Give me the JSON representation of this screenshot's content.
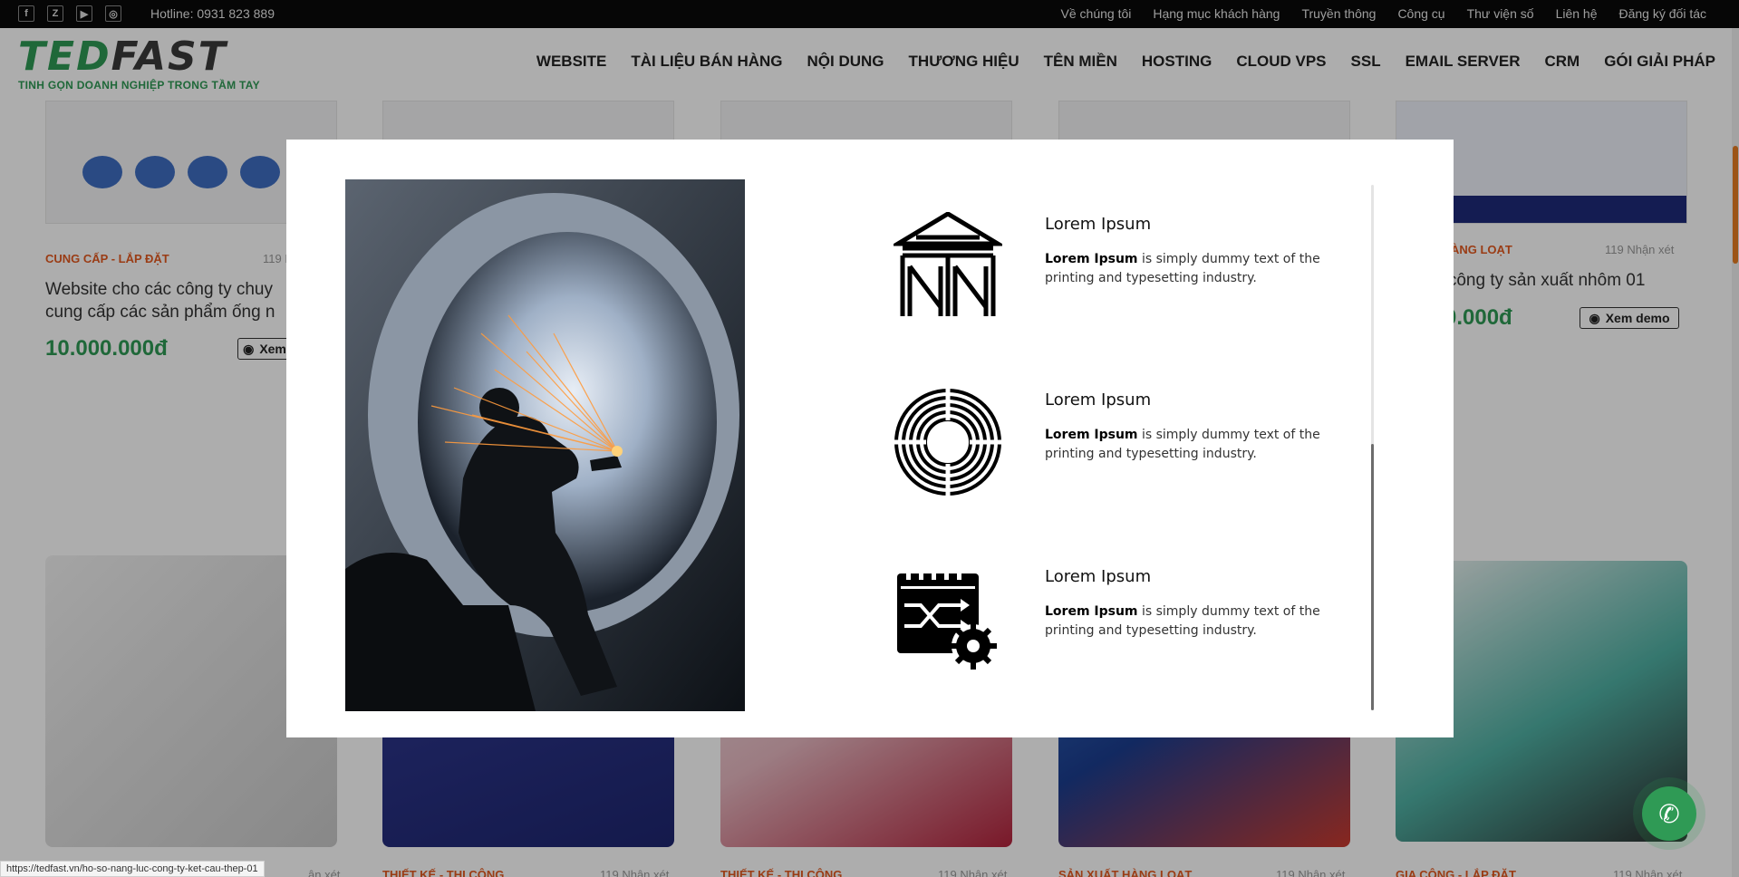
{
  "topbar": {
    "hotline": "Hotline: 0931 823 889",
    "links": [
      "Về chúng tôi",
      "Hạng mục khách hàng",
      "Truyền thông",
      "Công cụ",
      "Thư viện số",
      "Liên hệ",
      "Đăng ký đối tác"
    ],
    "socials": [
      "facebook-icon",
      "zalo-icon",
      "youtube-icon",
      "instagram-icon"
    ]
  },
  "header": {
    "logo_ted": "TED",
    "logo_fast": "FAST",
    "slogan": "TINH GỌN DOANH NGHIỆP TRONG TẦM TAY",
    "nav": [
      "WEBSITE",
      "TÀI LIỆU BÁN HÀNG",
      "NỘI DUNG",
      "THƯƠNG HIỆU",
      "TÊN MIỀN",
      "HOSTING",
      "CLOUD VPS",
      "SSL",
      "EMAIL SERVER",
      "CRM",
      "GÓI GIẢI PHÁP"
    ]
  },
  "cards_top": [
    {
      "category": "CUNG CẤP - LẮP ĐẶT",
      "reviews": "119 N",
      "title_line1": "Website cho các công ty chuy",
      "title_line2": "cung cấp các sản phẩm ống n",
      "price": "10.000.000đ",
      "demo": "Xem"
    },
    {
      "category": "T HÀNG LOẠT",
      "reviews": "119 Nhận xét",
      "title_line1": "e công ty sản xuất nhôm 01",
      "price": "0.000đ",
      "demo": "Xem demo"
    }
  ],
  "cards_bottom": [
    {
      "category": "",
      "reviews": "ận xét"
    },
    {
      "category": "THIẾT KẾ - THI CÔNG",
      "reviews": "119 Nhận xét"
    },
    {
      "category": "THIẾT KẾ - THI CÔNG",
      "reviews": "119 Nhận xét"
    },
    {
      "category": "SẢN XUẤT HÀNG LOẠT",
      "reviews": "119 Nhận xét"
    },
    {
      "category": "GIA CÔNG - LẮP ĐẶT",
      "reviews": "119 Nhận xét"
    }
  ],
  "modal": {
    "features": [
      {
        "icon": "warehouse-icon",
        "title": "Lorem Ipsum",
        "bold": "Lorem Ipsum",
        "text": " is simply dummy text of the printing and typesetting industry."
      },
      {
        "icon": "coil-icon",
        "title": "Lorem Ipsum",
        "bold": "Lorem Ipsum",
        "text": " is simply dummy text of the printing and typesetting industry."
      },
      {
        "icon": "calendar-gear-icon",
        "title": "Lorem Ipsum",
        "bold": "Lorem Ipsum",
        "text": " is simply dummy text of the printing and typesetting industry."
      }
    ]
  },
  "status_url": "https://tedfast.vn/ho-so-nang-luc-cong-ty-ket-cau-thep-01",
  "colors": {
    "accent": "#2f9a55",
    "category": "#e3591f",
    "topbar": "#0a0a0a"
  }
}
